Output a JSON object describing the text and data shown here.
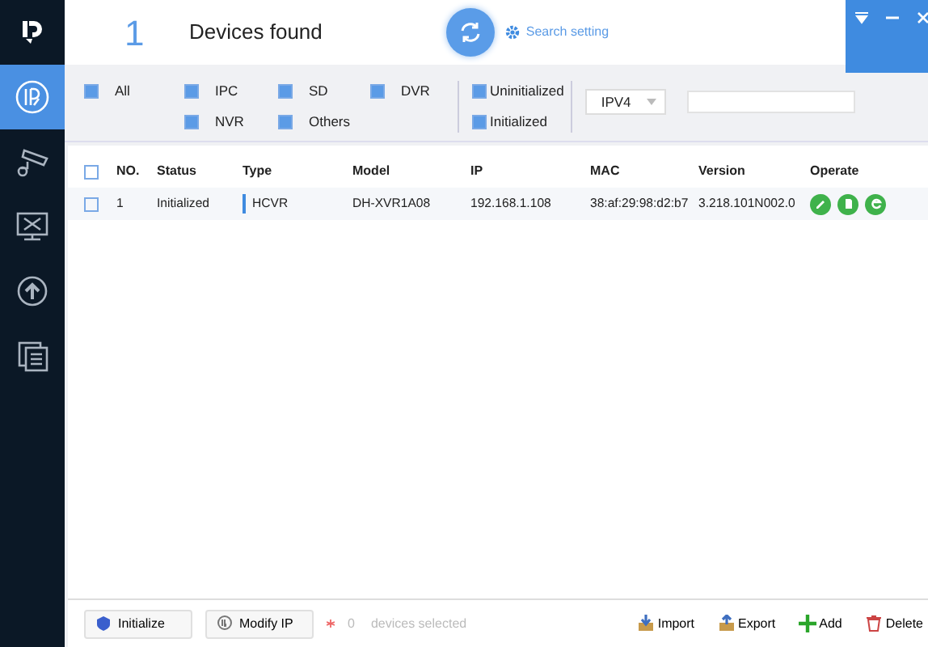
{
  "window_controls": [
    {
      "kind": "dropdown"
    },
    {
      "kind": "minimize"
    },
    {
      "kind": "close"
    }
  ],
  "sidebar": {
    "items": [
      {
        "kind": "ip",
        "selected": true
      },
      {
        "kind": "camera",
        "selected": false
      },
      {
        "kind": "tools",
        "selected": false
      },
      {
        "kind": "upgrade",
        "selected": false
      },
      {
        "kind": "pages",
        "selected": false
      }
    ]
  },
  "header": {
    "count": "1",
    "title": "Devices found",
    "search_setting": "Search setting"
  },
  "filters": {
    "device_types": [
      {
        "label": "All",
        "checked": true
      },
      {
        "label": "IPC",
        "checked": true
      },
      {
        "label": "SD",
        "checked": true
      },
      {
        "label": "DVR",
        "checked": true
      },
      {
        "label": "NVR",
        "checked": true
      },
      {
        "label": "Others",
        "checked": true
      }
    ],
    "status": [
      {
        "label": "Uninitialized",
        "checked": true
      },
      {
        "label": "Initialized",
        "checked": true
      }
    ],
    "protocol": "IPV4"
  },
  "table": {
    "select_all_checked": false,
    "columns": [
      "NO.",
      "Status",
      "Type",
      "Model",
      "IP",
      "MAC",
      "Version",
      "Operate"
    ],
    "rows": [
      {
        "checked": false,
        "no": "1",
        "status": "Initialized",
        "type": "HCVR",
        "model": "DH-XVR1A08",
        "ip": "192.168.1.108",
        "mac": "38:af:29:98:d2:b7",
        "version": "3.218.101N002.0",
        "operations": [
          {
            "kind": "edit"
          },
          {
            "kind": "details"
          },
          {
            "kind": "web"
          }
        ]
      }
    ]
  },
  "footer": {
    "buttons": [
      {
        "kind": "initialize",
        "label": "Initialize"
      },
      {
        "kind": "modify_ip",
        "label": "Modify IP"
      }
    ],
    "selected_count": "0",
    "selected_label": "devices selected",
    "actions": [
      {
        "kind": "import",
        "label": "Import"
      },
      {
        "kind": "export",
        "label": "Export"
      },
      {
        "kind": "add",
        "label": "Add"
      },
      {
        "kind": "delete",
        "label": "Delete"
      }
    ]
  }
}
